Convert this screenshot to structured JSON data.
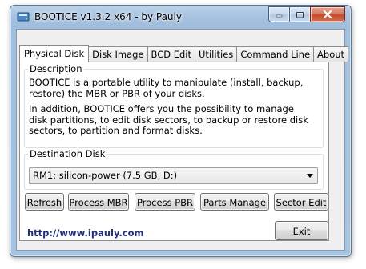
{
  "window": {
    "title": "BOOTICE v1.3.2 x64 - by Pauly"
  },
  "tabs": [
    {
      "label": "Physical Disk",
      "active": true
    },
    {
      "label": "Disk Image",
      "active": false
    },
    {
      "label": "BCD Edit",
      "active": false
    },
    {
      "label": "Utilities",
      "active": false
    },
    {
      "label": "Command Line",
      "active": false
    },
    {
      "label": "About",
      "active": false
    }
  ],
  "description": {
    "legend": "Description",
    "paragraph1": "BOOTICE is a portable utility to manipulate (install, backup, restore) the MBR or PBR of your disks.",
    "paragraph2": "In addition, BOOTICE offers you the possibility to manage disk partitions, to edit disk sectors, to backup or restore disk sectors, to partition and format disks."
  },
  "destination": {
    "legend": "Destination Disk",
    "selected_value": "RM1:  silicon-power (7.5 GB, D:)"
  },
  "actions": {
    "refresh": "Refresh",
    "process_mbr": "Process MBR",
    "process_pbr": "Process PBR",
    "parts_manage": "Parts Manage",
    "sector_edit": "Sector Edit"
  },
  "footer": {
    "link": "http://www.ipauly.com",
    "exit": "Exit"
  },
  "colors": {
    "frame": "#a6c3e0",
    "close_button": "#c24a2a",
    "link": "#1f2f7a"
  },
  "icons": {
    "app": "bootice-app-icon",
    "minimize": "minimize-icon",
    "maximize": "maximize-icon",
    "close": "close-icon",
    "dropdown": "chevron-down-icon"
  }
}
